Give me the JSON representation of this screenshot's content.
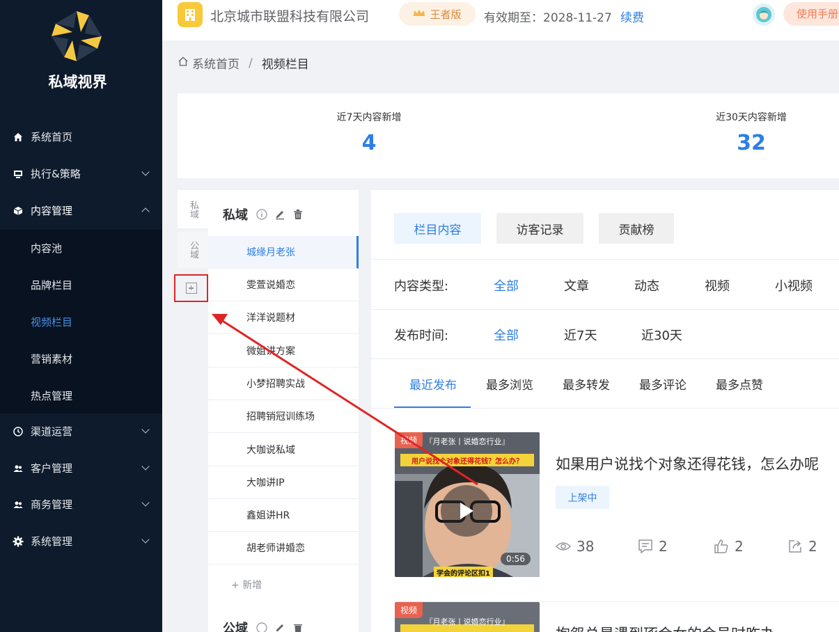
{
  "sidebar": {
    "brand": "私域视界",
    "items": [
      {
        "label": "系统首页",
        "icon": "home-icon"
      },
      {
        "label": "执行&策略",
        "icon": "strategy-icon"
      },
      {
        "label": "内容管理",
        "icon": "cube-icon"
      },
      {
        "label": "渠道运营",
        "icon": "clock-icon"
      },
      {
        "label": "客户管理",
        "icon": "users-icon"
      },
      {
        "label": "商务管理",
        "icon": "users-icon"
      },
      {
        "label": "系统管理",
        "icon": "gear-icon"
      }
    ],
    "sub_items": [
      "内容池",
      "品牌栏目",
      "视频栏目",
      "营销素材",
      "热点管理"
    ]
  },
  "header": {
    "company": "北京城市联盟科技有限公司",
    "vip": "王者版",
    "expire": "有效期至：2028-11-27",
    "renew": "续费",
    "manual": "使用手册"
  },
  "breadcrumb": {
    "home": "系统首页",
    "sep": "/",
    "current": "视频栏目"
  },
  "stats": [
    {
      "label": "近7天内容新增",
      "value": "4"
    },
    {
      "label": "近30天内容新增",
      "value": "32"
    }
  ],
  "vtabs": {
    "private": "私域",
    "public": "公域"
  },
  "columns": {
    "private_title": "私域",
    "public_title": "公域",
    "items": [
      "城缘月老张",
      "雯萱说婚恋",
      "洋洋说题材",
      "微姐讲方案",
      "小梦招聘实战",
      "招聘销冠训练场",
      "大咖说私域",
      "大咖讲IP",
      "鑫姐讲HR",
      "胡老师讲婚恋"
    ],
    "add": "+ 新增"
  },
  "main": {
    "tabs": [
      "栏目内容",
      "访客记录",
      "贡献榜"
    ],
    "content_type_label": "内容类型:",
    "content_types": [
      "全部",
      "文章",
      "动态",
      "视频",
      "小视频"
    ],
    "publish_time_label": "发布时间:",
    "publish_times": [
      "全部",
      "近7天",
      "近30天"
    ],
    "sorts": [
      "最近发布",
      "最多浏览",
      "最多转发",
      "最多评论",
      "最多点赞"
    ],
    "cards": [
      {
        "badge": "视频",
        "title": "如果用户说找个对象还得花钱，怎么办呢",
        "status": "上架中",
        "duration": "0:56",
        "thumb_top": "『月老张丨说婚恋行业』",
        "thumb_caption": "用户说找个对象还得花钱？怎么办？",
        "thumb_bottom": "学会的评论区扣1",
        "views": "38",
        "comments": "2",
        "likes": "2",
        "shares": "2"
      },
      {
        "badge": "视频",
        "title": "抱怨总是遇到琢会女的会员时咋办",
        "thumb_top": "『月老张丨说婚恋行业』"
      }
    ]
  },
  "colors": {
    "accent": "#2d7fe3",
    "sidebar": "#0e1b2c",
    "annotation": "#e02424"
  }
}
